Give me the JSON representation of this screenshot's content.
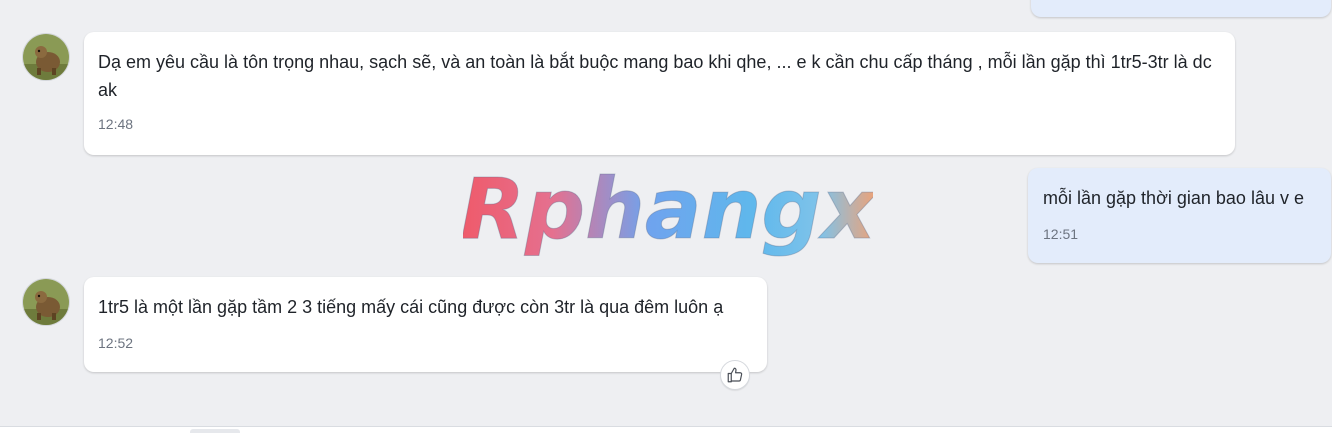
{
  "messages": [
    {
      "text": "Dạ em yêu cầu là tôn trọng nhau, sạch sẽ, và an toàn là bắt buộc mang bao khi qhe, ... e k cần chu cấp tháng , mỗi lần gặp thì 1tr5-3tr là dc ak",
      "time": "12:48"
    },
    {
      "text": "mỗi lần gặp thời gian bao lâu v e",
      "time": "12:51"
    },
    {
      "text": "1tr5 là một lần gặp tầm 2 3 tiếng mấy cái cũng được còn 3tr là qua đêm luôn ạ",
      "time": "12:52"
    }
  ],
  "watermark": "Rphangx",
  "icons": {
    "avatar": "contact-avatar-icon",
    "reaction": "thumbs-up-icon"
  },
  "colors": {
    "background": "#eeeff2",
    "incoming_bubble": "#ffffff",
    "outgoing_bubble": "#e3ecfb"
  }
}
